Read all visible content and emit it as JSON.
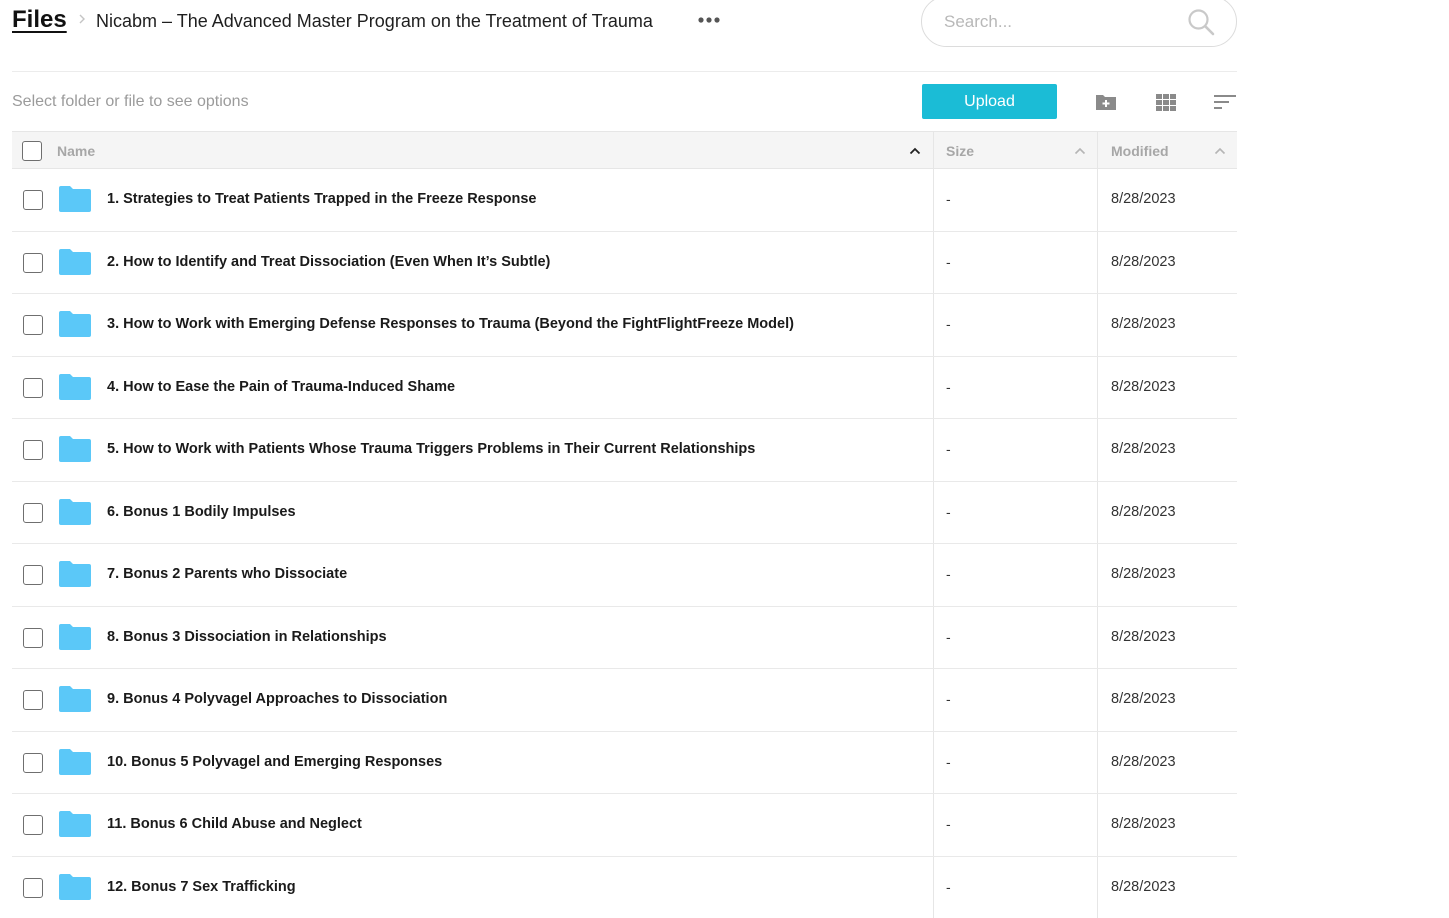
{
  "header": {
    "root_label": "Files",
    "current_folder": "Nicabm – The Advanced Master Program on the Treatment of Trauma"
  },
  "search": {
    "placeholder": "Search..."
  },
  "toolbar": {
    "hint": "Select folder or file to see options",
    "upload_label": "Upload",
    "icons": [
      "create-folder-icon",
      "grid-view-icon",
      "sort-icon"
    ]
  },
  "table": {
    "columns": {
      "name": "Name",
      "size": "Size",
      "modified": "Modified"
    },
    "rows": [
      {
        "name": "1. Strategies to Treat Patients Trapped in the Freeze Response",
        "size": "-",
        "modified": "8/28/2023"
      },
      {
        "name": "2. How to Identify and Treat Dissociation (Even When It’s Subtle)",
        "size": "-",
        "modified": "8/28/2023"
      },
      {
        "name": "3. How to Work with Emerging Defense Responses to Trauma (Beyond the FightFlightFreeze Model)",
        "size": "-",
        "modified": "8/28/2023"
      },
      {
        "name": "4. How to Ease the Pain of Trauma-Induced Shame",
        "size": "-",
        "modified": "8/28/2023"
      },
      {
        "name": "5. How to Work with Patients Whose Trauma Triggers Problems in Their Current Relationships",
        "size": "-",
        "modified": "8/28/2023"
      },
      {
        "name": "6. Bonus 1 Bodily Impulses",
        "size": "-",
        "modified": "8/28/2023"
      },
      {
        "name": "7. Bonus 2 Parents who Dissociate",
        "size": "-",
        "modified": "8/28/2023"
      },
      {
        "name": "8. Bonus 3 Dissociation in Relationships",
        "size": "-",
        "modified": "8/28/2023"
      },
      {
        "name": "9. Bonus 4 Polyvagel Approaches to Dissociation",
        "size": "-",
        "modified": "8/28/2023"
      },
      {
        "name": "10. Bonus 5 Polyvagel and Emerging Responses",
        "size": "-",
        "modified": "8/28/2023"
      },
      {
        "name": "11. Bonus 6 Child Abuse and Neglect",
        "size": "-",
        "modified": "8/28/2023"
      },
      {
        "name": "12. Bonus 7 Sex Trafficking",
        "size": "-",
        "modified": "8/28/2023"
      }
    ]
  },
  "colors": {
    "accent": "#1bbcd6",
    "folder": "#5bc8f8"
  }
}
